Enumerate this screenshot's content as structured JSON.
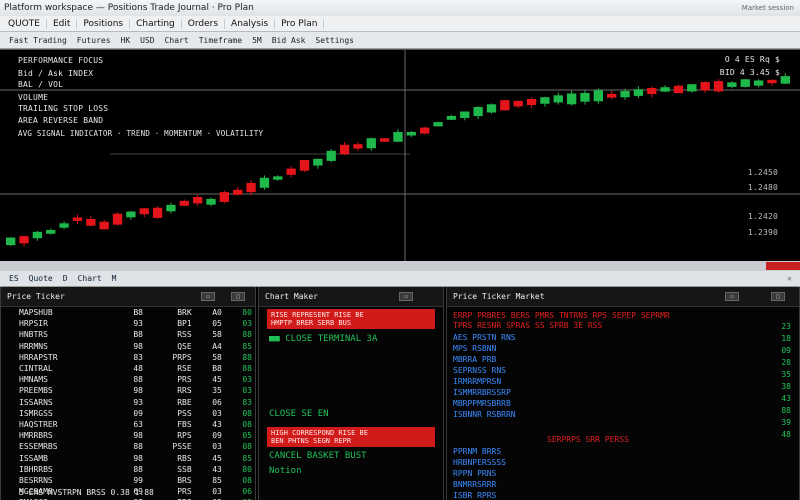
{
  "window": {
    "title": "Platform workspace — Positions Trade Journal · Pro Plan",
    "right_text": "Market session"
  },
  "menu": [
    "QUOTE",
    "Edit",
    "Positions",
    "Charting",
    "Orders",
    "Analysis",
    "Pro Plan"
  ],
  "toolbar": [
    "Fast Trading",
    "Futures",
    "HK",
    "USD",
    "Chart",
    "Timeframe",
    "5M",
    "Bid Ask",
    "Settings"
  ],
  "colors": {
    "up": "#1fb84a",
    "down": "#e3141a",
    "accent": "#d11a1a",
    "blue": "#3a8cff"
  },
  "chart": {
    "info_lines": [
      "PERFORMANCE FOCUS",
      "Bid / Ask INDEX",
      "BAL / VOL",
      "VOLUME",
      "TRAILING STOP LOSS",
      "AREA REVERSE BAND"
    ],
    "indicator_line": "AVG SIGNAL INDICATOR · TREND · MOMENTUM · VOLATILITY",
    "quote_lines": [
      "O 4 ES Rq  $",
      "BID 4 3.45  $"
    ],
    "axis_labels": [
      "1.2450",
      "1.2480",
      "1.2420",
      "1.2390"
    ]
  },
  "chart_data": {
    "type": "candlestick",
    "trend": [
      8,
      9,
      12,
      14,
      18,
      22,
      20,
      18,
      22,
      25,
      27,
      26,
      29,
      32,
      34,
      33,
      36,
      39,
      42,
      45,
      48,
      52,
      56,
      58,
      62,
      66,
      68,
      70,
      72,
      74,
      76,
      78,
      82,
      86,
      88,
      90,
      92,
      94,
      95,
      96,
      97,
      98,
      98,
      99,
      100,
      100,
      101,
      102,
      103,
      104,
      104,
      105,
      106,
      106,
      107,
      108,
      108,
      109,
      110
    ],
    "grid": true
  },
  "tabs": [
    "ES",
    "Quote",
    "D",
    "Chart",
    "M"
  ],
  "watchlist": {
    "title": "Price Ticker",
    "rows": [
      [
        "MAPSHUB",
        "B8",
        "BRK",
        "A0",
        "80"
      ],
      [
        "HRPSIR",
        "93",
        "BP1",
        "05",
        "03"
      ],
      [
        "HNBTRS",
        "B8",
        "RSS",
        "58",
        "88"
      ],
      [
        "HRRMNS",
        "98",
        "QSE",
        "A4",
        "85"
      ],
      [
        "HRRAPSTR",
        "83",
        "PRPS",
        "58",
        "88"
      ],
      [
        "CINTRAL",
        "48",
        "RSE",
        "B8",
        "88"
      ],
      [
        "HMNAMS",
        "88",
        "PRS",
        "45",
        "03"
      ],
      [
        "PREEMBS",
        "98",
        "RRS",
        "35",
        "03"
      ],
      [
        "ISSARNS",
        "93",
        "RBE",
        "06",
        "83"
      ],
      [
        "ISMRGSS",
        "09",
        "PSS",
        "03",
        "08"
      ],
      [
        "HAQSTRER",
        "63",
        "FBS",
        "43",
        "08"
      ],
      [
        "HMRRBRS",
        "98",
        "RPS",
        "09",
        "05"
      ],
      [
        "ESSEMRBS",
        "88",
        "PSSE",
        "03",
        "08"
      ],
      [
        "ISSAMB",
        "98",
        "RBS",
        "45",
        "85"
      ],
      [
        "IBHRRBS",
        "88",
        "SSB",
        "43",
        "80"
      ],
      [
        "BESRRNS",
        "99",
        "BRS",
        "85",
        "08"
      ],
      [
        "MGCSAMS",
        "69",
        "PRS",
        "03",
        "06"
      ],
      [
        "EMASGS",
        "08",
        "PPS",
        "03",
        "03"
      ]
    ],
    "footer": "5 EMS  MVSTRPN  BRSS  0.38  1.88"
  },
  "orders": {
    "title": "Chart Maker",
    "bar1": [
      "RISE REPRESENT RISE BE",
      "HMPTP BRER SERB BUS"
    ],
    "green1": "■■ CLOSE  TERMINAL  3A",
    "green2": "CLOSE SE EN",
    "bar2": [
      "HIGH CORRESPOND RISE BE",
      "BEN PHTNS SEGN REPR"
    ],
    "green3": "CANCEL BASKET  BUST",
    "green4": "Notion"
  },
  "ticker": {
    "title": "Price Ticker Market",
    "red_lines": [
      "ERRP PRBRES BERS PMRS  TNTRNS RPS SEPEP SEPRMR",
      "TPRS RESNR SPRAS  SS  SPRB 3E  RSS"
    ],
    "blue_lines": [
      "AES PRSTN RNS",
      "MPS RSBNN",
      "MBRRA PRB",
      "SEPRNSS RNS",
      "IRMRRMPRSN",
      "ISMMRRBRSSRP",
      "MBRPPMRSBRRB",
      "ISBNNR RSBRRN"
    ],
    "blue_lines2": [
      "PPRNM  BRRS",
      "HRBNPERSSSS",
      "RPPN PRNS",
      "BNMRRSRRR",
      "ISBR RPRS",
      "BSRM RRS"
    ],
    "red_mid": "SERPRPS  SRR PERSS",
    "side_values": [
      "23",
      "18",
      "09",
      "28",
      "35",
      "38",
      "43",
      "88",
      "39",
      "48"
    ]
  }
}
